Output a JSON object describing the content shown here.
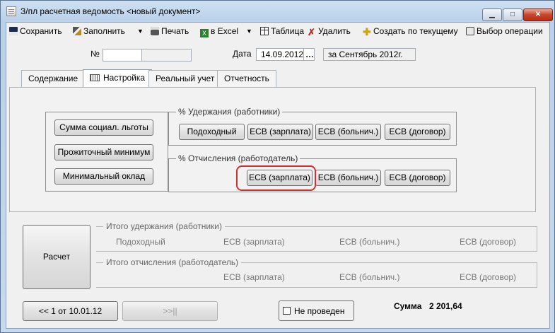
{
  "window": {
    "title": "З/пл расчетная ведомость <новый документ>",
    "min_glyph": "▁",
    "max_glyph": "□",
    "close_glyph": "✕"
  },
  "toolbar": {
    "save": "Сохранить",
    "fill": "Заполнить",
    "fill_arrow": "▼",
    "print": "Печать",
    "excel": "в Excel",
    "excel_arrow": "▼",
    "table": "Таблица",
    "delete": "Удалить",
    "create_from_current": "Создать по текущему",
    "choose_operation": "Выбор операции"
  },
  "header": {
    "number_label": "№",
    "number_value": "",
    "number_value2": "",
    "date_label": "Дата",
    "date_value": "14.09.2012",
    "date_picker": "…",
    "period_value": "за Сентябрь 2012г."
  },
  "tabs": [
    {
      "label": "Содержание"
    },
    {
      "label": "Настройка"
    },
    {
      "label": "Реальный учет"
    },
    {
      "label": "Отчетность"
    }
  ],
  "settings": {
    "left_buttons": [
      "Сумма социал. льготы",
      "Прожиточный минимум",
      "Минимальный оклад"
    ],
    "deductions_title": "% Удержания (работники)",
    "deductions_buttons": [
      "Подоходный",
      "ЕСВ (зарплата)",
      "ЕСВ (больнич.)",
      "ЕСВ (договор)"
    ],
    "charges_title": "% Отчисления (работодатель)",
    "charges_buttons": [
      "ЕСВ (зарплата)",
      "ЕСВ (больнич.)",
      "ЕСВ (договор)"
    ]
  },
  "totals": {
    "calc_button": "Расчет",
    "deductions_title": "Итого удержания (работники)",
    "deductions_items": [
      "Подоходный",
      "ЕСВ (зарплата)",
      "ЕСВ (больнич.)",
      "ЕСВ (договор)"
    ],
    "charges_title": "Итого отчисления (работодатель)",
    "charges_items": [
      "ЕСВ (зарплата)",
      "ЕСВ (больнич.)",
      "ЕСВ (договор)"
    ]
  },
  "footer": {
    "prev_button": "<< 1 от 10.01.12",
    "next_button": ">>||",
    "not_posted_label": "Не проведен",
    "sum_label": "Сумма",
    "sum_value": "2 201,64"
  },
  "colors": {
    "highlight": "#d03030"
  }
}
